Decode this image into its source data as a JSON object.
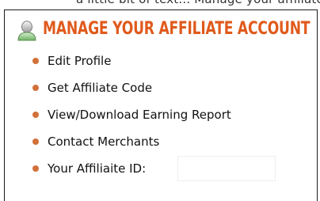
{
  "top_strip": {
    "text": "a little bit of text... Manage your affiliate account"
  },
  "header": {
    "title": "MANAGE YOUR AFFILIATE ACCOUNT",
    "icon": "user-icon"
  },
  "menu": {
    "items": [
      {
        "label": "Edit Profile"
      },
      {
        "label": "Get Affiliate Code"
      },
      {
        "label": "View/Download Earning Report"
      },
      {
        "label": "Contact Merchants"
      },
      {
        "label": "Your Affiliaite ID:"
      }
    ],
    "affiliate_id_value": ""
  },
  "colors": {
    "accent": "#e05a1c",
    "bullet": "#d2703a",
    "text": "#111111",
    "border": "#1a1a1a"
  }
}
